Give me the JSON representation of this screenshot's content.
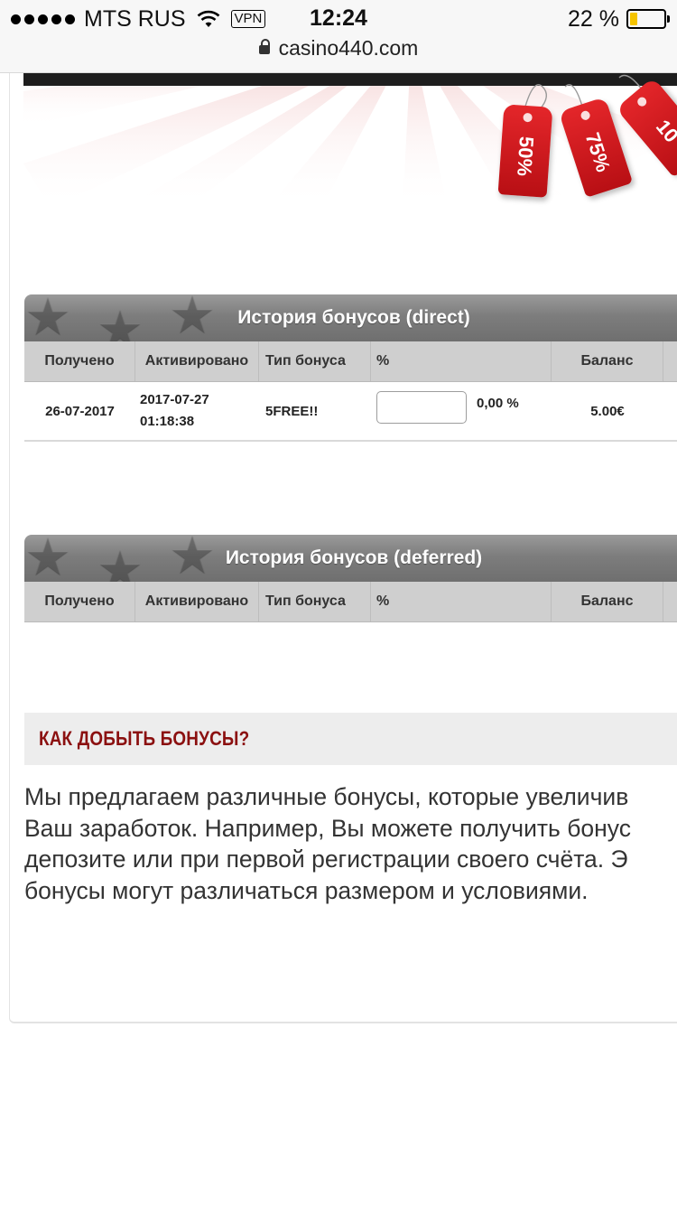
{
  "status_bar": {
    "carrier": "MTS RUS",
    "vpn": "VPN",
    "time": "12:24",
    "battery_percent_label": "22 %",
    "battery_level": 0.22,
    "url": "casino440.com"
  },
  "banner": {
    "tags": [
      "50%",
      "75%",
      "10"
    ]
  },
  "colors": {
    "header_gray": "#7d7d7d",
    "column_gray": "#cfcfcf",
    "accent_red": "#8b1010",
    "tag_red": "#d81e23"
  },
  "direct_table": {
    "title": "История бонусов (direct)",
    "columns": [
      "Получено",
      "Активировано",
      "Тип бонуса",
      "%",
      "Баланс"
    ],
    "rows": [
      {
        "received": "26-07-2017",
        "activated_date": "2017-07-27",
        "activated_time": "01:18:38",
        "type": "5FREE!!",
        "percent": "0,00 %",
        "balance": "5.00€"
      }
    ]
  },
  "deferred_table": {
    "title": "История бонусов (deferred)",
    "columns": [
      "Получено",
      "Активировано",
      "Тип бонуса",
      "%",
      "Баланс"
    ]
  },
  "howto": {
    "title": "КАК ДОБЫТЬ БОНУСЫ?",
    "lines": [
      "Мы предлагаем различные бонусы, которые увеличив",
      "Ваш заработок. Например, Вы можете получить бонус",
      "депозите или при первой регистрации своего счёта. Э",
      "бонусы могут различаться размером и условиями."
    ]
  }
}
